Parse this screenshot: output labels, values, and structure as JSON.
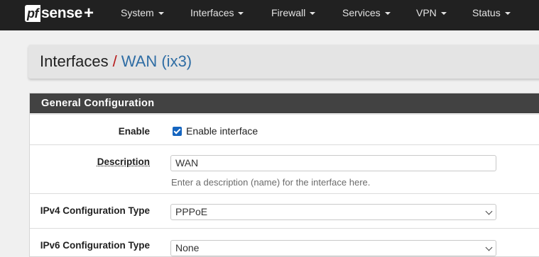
{
  "brand": {
    "pf": "pf",
    "sense": "sense",
    "plus": "+"
  },
  "nav": {
    "items": [
      {
        "label": "System"
      },
      {
        "label": "Interfaces"
      },
      {
        "label": "Firewall"
      },
      {
        "label": "Services"
      },
      {
        "label": "VPN"
      },
      {
        "label": "Status"
      }
    ]
  },
  "breadcrumb": {
    "section": "Interfaces",
    "separator": "/",
    "current": "WAN (ix3)"
  },
  "panel": {
    "title": "General Configuration",
    "enable": {
      "label": "Enable",
      "checkbox_label": "Enable interface",
      "checked": true
    },
    "description": {
      "label": "Description",
      "value": "WAN",
      "help": "Enter a description (name) for the interface here."
    },
    "ipv4_type": {
      "label": "IPv4 Configuration Type",
      "value": "PPPoE"
    },
    "ipv6_type": {
      "label": "IPv6 Configuration Type",
      "value": "None"
    }
  },
  "colors": {
    "navbar": "#212121",
    "panel_heading": "#424242",
    "link": "#2f6da4",
    "separator": "#b71c1c",
    "checkbox": "#1565c0"
  }
}
